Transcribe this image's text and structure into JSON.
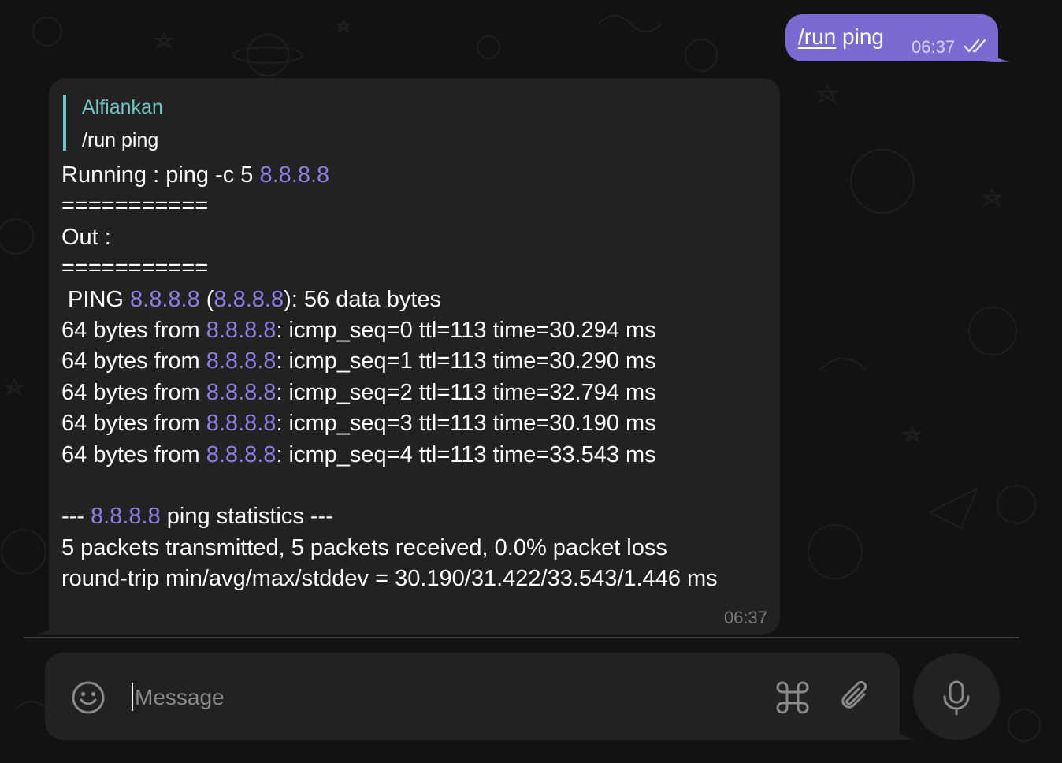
{
  "outgoing": {
    "command": "/run",
    "argument": " ping",
    "time": "06:37",
    "status_icon": "double-check-icon"
  },
  "incoming": {
    "reply": {
      "author": "Alfiankan",
      "text": "/run ping"
    },
    "lines": [
      [
        {
          "t": "Running : ping -c 5 "
        },
        {
          "t": "8.8.8.8",
          "ip": true
        }
      ],
      [
        {
          "t": "==========="
        }
      ],
      [
        {
          "t": "Out :"
        }
      ],
      [
        {
          "t": "==========="
        }
      ],
      [
        {
          "t": " PING "
        },
        {
          "t": "8.8.8.8",
          "ip": true
        },
        {
          "t": " ("
        },
        {
          "t": "8.8.8.8",
          "ip": true
        },
        {
          "t": "): 56 data bytes"
        }
      ],
      [
        {
          "t": "64 bytes from "
        },
        {
          "t": "8.8.8.8",
          "ip": true
        },
        {
          "t": ": icmp_seq=0 ttl=113 time=30.294 ms"
        }
      ],
      [
        {
          "t": "64 bytes from "
        },
        {
          "t": "8.8.8.8",
          "ip": true
        },
        {
          "t": ": icmp_seq=1 ttl=113 time=30.290 ms"
        }
      ],
      [
        {
          "t": "64 bytes from "
        },
        {
          "t": "8.8.8.8",
          "ip": true
        },
        {
          "t": ": icmp_seq=2 ttl=113 time=32.794 ms"
        }
      ],
      [
        {
          "t": "64 bytes from "
        },
        {
          "t": "8.8.8.8",
          "ip": true
        },
        {
          "t": ": icmp_seq=3 ttl=113 time=30.190 ms"
        }
      ],
      [
        {
          "t": "64 bytes from "
        },
        {
          "t": "8.8.8.8",
          "ip": true
        },
        {
          "t": ": icmp_seq=4 ttl=113 time=33.543 ms"
        }
      ],
      [
        {
          "t": ""
        }
      ],
      [
        {
          "t": "--- "
        },
        {
          "t": "8.8.8.8",
          "ip": true
        },
        {
          "t": " ping statistics ---"
        }
      ],
      [
        {
          "t": "5 packets transmitted, 5 packets received, 0.0% packet loss"
        }
      ],
      [
        {
          "t": "round-trip min/avg/max/stddev = 30.190/31.422/33.543/1.446 ms"
        }
      ]
    ],
    "time": "06:37"
  },
  "composer": {
    "placeholder": "Message",
    "value": "",
    "emoji_icon": "smiley-icon",
    "command_icon": "command-key-icon",
    "attach_icon": "paperclip-icon",
    "mic_icon": "microphone-icon"
  },
  "colors": {
    "background": "#121212",
    "outgoing_bubble": "#7a6ad2",
    "incoming_bubble": "#222222",
    "link": "#8e7fe6",
    "reply_accent": "#6ec6c6",
    "timestamp": "#7b7b7b"
  }
}
